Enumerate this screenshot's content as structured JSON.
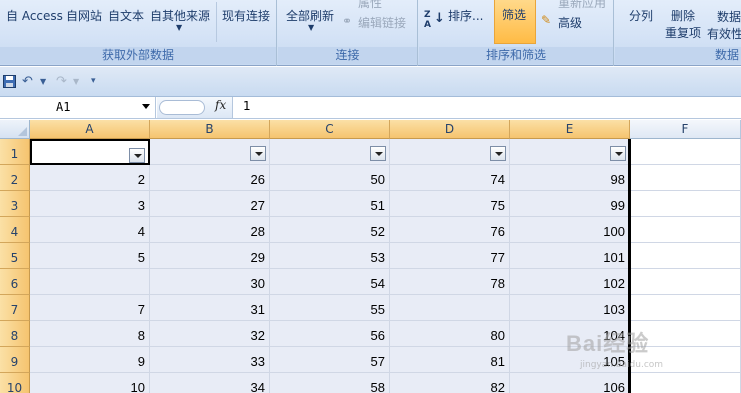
{
  "ribbon": {
    "external_data": {
      "buttons": [
        "自 Access",
        "自网站",
        "自文本",
        "自其他来源",
        "现有连接"
      ],
      "label": "获取外部数据"
    },
    "connections": {
      "refresh_all": "全部刷新",
      "properties": "属性",
      "edit_links": "编辑链接",
      "label": "连接"
    },
    "sort_filter": {
      "sort": "排序...",
      "filter": "筛选",
      "reapply": "重新应用",
      "advanced": "高级",
      "label": "排序和筛选"
    },
    "data_tools": {
      "split": "分列",
      "remove_dup_1": "删除",
      "remove_dup_2": "重复项",
      "validation_1": "数据",
      "validation_2": "有效性",
      "label": "数据"
    }
  },
  "formula_bar": {
    "name_box": "A1",
    "fx": "fx",
    "value": "1"
  },
  "sheet": {
    "columns": [
      "A",
      "B",
      "C",
      "D",
      "E",
      "F"
    ],
    "rows": [
      {
        "num": "1",
        "cells": [
          "",
          "",
          "",
          "",
          ""
        ]
      },
      {
        "num": "2",
        "cells": [
          "2",
          "26",
          "50",
          "74",
          "98"
        ]
      },
      {
        "num": "3",
        "cells": [
          "3",
          "27",
          "51",
          "75",
          "99"
        ]
      },
      {
        "num": "4",
        "cells": [
          "4",
          "28",
          "52",
          "76",
          "100"
        ]
      },
      {
        "num": "5",
        "cells": [
          "5",
          "29",
          "53",
          "77",
          "101"
        ]
      },
      {
        "num": "6",
        "cells": [
          "",
          "30",
          "54",
          "78",
          "102"
        ]
      },
      {
        "num": "7",
        "cells": [
          "7",
          "31",
          "55",
          "",
          "103"
        ]
      },
      {
        "num": "8",
        "cells": [
          "8",
          "32",
          "56",
          "80",
          "104"
        ]
      },
      {
        "num": "9",
        "cells": [
          "9",
          "33",
          "57",
          "81",
          "105"
        ]
      },
      {
        "num": "10",
        "cells": [
          "10",
          "34",
          "58",
          "82",
          "106"
        ]
      }
    ]
  },
  "watermark": {
    "text": "Bai经验",
    "sub": "jingyan.baidu.com"
  },
  "colors": {
    "header_selected": "#f8cb7e",
    "selection_fill": "#e8ecf6",
    "ribbon_bg": "#d5e3f6"
  }
}
